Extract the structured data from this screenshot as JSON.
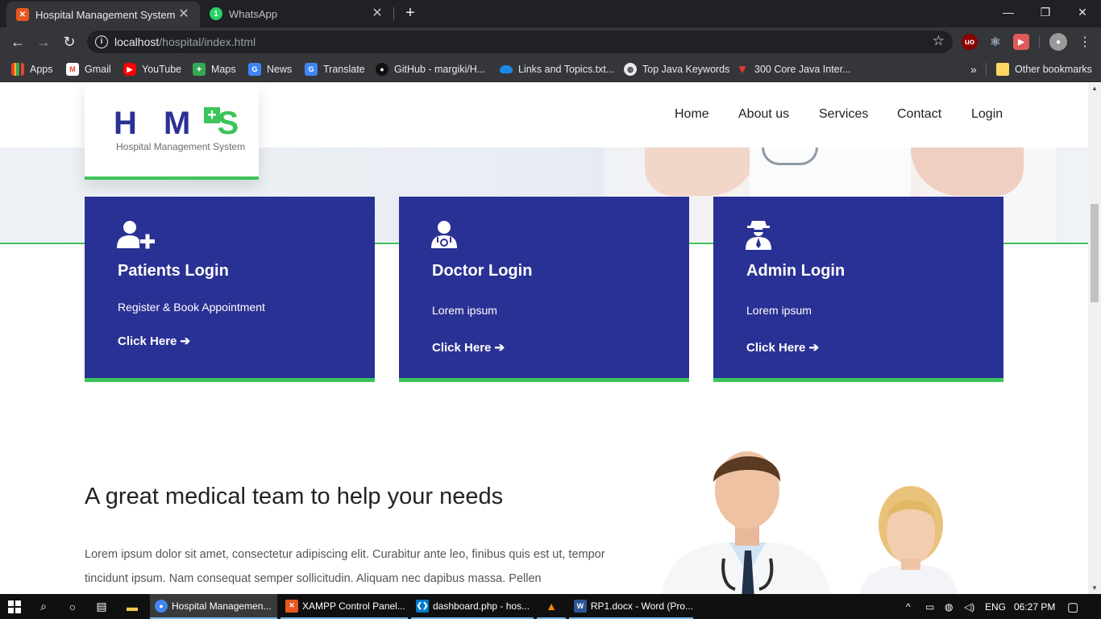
{
  "browser": {
    "tabs": [
      {
        "title": "Hospital Management System",
        "favicon": "xampp-icon",
        "color": "#e8571e"
      },
      {
        "title": "WhatsApp",
        "favicon": "whatsapp-icon",
        "color": "#25d366"
      }
    ],
    "url_host": "localhost",
    "url_path": "/hospital/index.html",
    "bookmarks": [
      {
        "label": "Apps",
        "icon": "apps-grid-icon"
      },
      {
        "label": "Gmail",
        "icon": "gmail-icon"
      },
      {
        "label": "YouTube",
        "icon": "youtube-icon"
      },
      {
        "label": "Maps",
        "icon": "maps-icon"
      },
      {
        "label": "News",
        "icon": "news-icon"
      },
      {
        "label": "Translate",
        "icon": "translate-icon"
      },
      {
        "label": "GitHub - margiki/H...",
        "icon": "github-icon"
      },
      {
        "label": "Links and Topics.txt...",
        "icon": "onedrive-icon"
      },
      {
        "label": "Top Java Keywords",
        "icon": "globe-icon"
      },
      {
        "label": "300 Core Java Inter...",
        "icon": "bookmark-red-icon"
      },
      {
        "label": "Other bookmarks",
        "icon": "folder-icon"
      }
    ]
  },
  "site": {
    "logo_letters": "H M ",
    "logo_s": "S",
    "logo_plus": "+",
    "logo_subtitle": "Hospital Management System",
    "nav": [
      "Home",
      "About us",
      "Services",
      "Contact",
      "Login"
    ],
    "brand_color": "#2a3194",
    "accent_color": "#3cc45a",
    "cards": [
      {
        "title": "Patients Login",
        "desc": "Register & Book Appointment",
        "link": "Click Here",
        "icon": "user-plus-icon"
      },
      {
        "title": "Doctor Login",
        "desc": "Lorem ipsum",
        "link": "Click Here",
        "icon": "user-doctor-icon"
      },
      {
        "title": "Admin Login",
        "desc": "Lorem ipsum",
        "link": "Click Here",
        "icon": "user-secret-icon"
      }
    ],
    "team_heading": "A great medical team to help your needs",
    "team_text": "Lorem ipsum dolor sit amet, consectetur adipiscing elit. Curabitur ante leo, finibus quis est ut, tempor tincidunt ipsum. Nam consequat semper sollicitudin. Aliquam nec dapibus massa. Pellen"
  },
  "taskbar": {
    "apps": [
      {
        "label": "Hospital Managemen...",
        "icon": "chrome-icon",
        "color": "#4285f4"
      },
      {
        "label": "XAMPP Control Panel...",
        "icon": "xampp-icon",
        "color": "#e8571e"
      },
      {
        "label": "dashboard.php - hos...",
        "icon": "vscode-icon",
        "color": "#007acc"
      },
      {
        "label": "RP1.docx - Word (Pro...",
        "icon": "word-icon",
        "color": "#2b579a"
      }
    ],
    "language": "ENG",
    "time": "06:27 PM"
  }
}
